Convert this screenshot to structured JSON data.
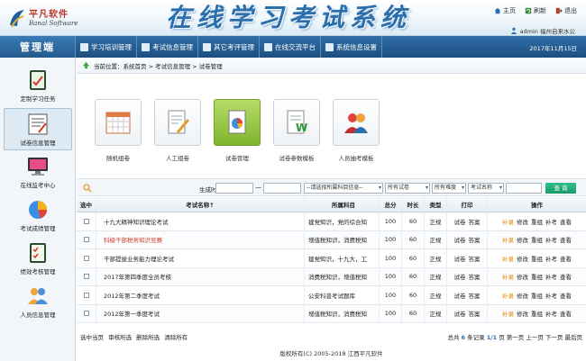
{
  "brand": {
    "name_cn": "平凡软件",
    "name_en": "Banal Software"
  },
  "app_title": "在线学习考试系统",
  "top_links": [
    {
      "label": "主页",
      "icon": "home-icon"
    },
    {
      "label": "刷新",
      "icon": "refresh-icon"
    },
    {
      "label": "退出",
      "icon": "exit-icon"
    }
  ],
  "user_line": "admin 福州自来水公",
  "sidebar_title": "管理端",
  "nav": [
    {
      "label": "学习培训管理"
    },
    {
      "label": "考试信息管理"
    },
    {
      "label": "其它考评管理"
    },
    {
      "label": "在线交流平台"
    },
    {
      "label": "系统信息设置"
    }
  ],
  "date": "2017年11月15日",
  "sidebar": [
    {
      "label": "定制学习任务",
      "icon": "task-icon"
    },
    {
      "label": "试卷信息管理",
      "icon": "exam-paper-icon",
      "active": true
    },
    {
      "label": "在线监考中心",
      "icon": "monitor-icon"
    },
    {
      "label": "考试成绩管理",
      "icon": "pie-chart-icon"
    },
    {
      "label": "绩效考核管理",
      "icon": "checklist-icon"
    },
    {
      "label": "人员信息管理",
      "icon": "users-icon"
    }
  ],
  "breadcrumb": "当前位置：系统首页 > 考试信息管理 > 试卷管理",
  "tiles": [
    {
      "label": "随机组卷",
      "icon": "calendar-grid-icon"
    },
    {
      "label": "人工组卷",
      "icon": "document-pen-icon"
    },
    {
      "label": "试卷管理",
      "icon": "paper-pie-icon",
      "active": true
    },
    {
      "label": "试卷参数模板",
      "icon": "word-doc-icon"
    },
    {
      "label": "人员抽考模板",
      "icon": "people-icon"
    }
  ],
  "filter": {
    "time_label": "生成时间",
    "date_from": "",
    "dash": "—",
    "date_to": "",
    "subject_select": "--请选择所属科目信息--",
    "exam_select": "所有试卷",
    "difficulty_select": "所有难度",
    "sort_select": "考试名称",
    "keyword": "",
    "query_button": "查 询"
  },
  "table": {
    "headers": [
      "选中",
      "考试名称↑",
      "所属科目",
      "总分",
      "时长",
      "类型",
      "打印",
      "操作"
    ],
    "rows": [
      {
        "name": "十九大精神知识理论考试",
        "subject": "建党知识，党的综合知",
        "total": "100",
        "duration": "60",
        "type": "正规",
        "print": [
          "试卷",
          "答案"
        ],
        "red": false
      },
      {
        "name": "科级干部税务知识竞赛",
        "subject": "增值税知识，消费税知",
        "total": "100",
        "duration": "60",
        "type": "正规",
        "print": [
          "试卷",
          "答案"
        ],
        "red": true
      },
      {
        "name": "干部提拔业务能力理论考试",
        "subject": "建党知识，十九大，工",
        "total": "100",
        "duration": "60",
        "type": "正规",
        "print": [
          "试卷",
          "答案"
        ],
        "red": false
      },
      {
        "name": "2017年第四季度全员考核",
        "subject": "消费税知识，增值税知",
        "total": "100",
        "duration": "60",
        "type": "正规",
        "print": [
          "试卷",
          "答案"
        ],
        "red": false
      },
      {
        "name": "2012年第二季度考试",
        "subject": "公安科普考试题库",
        "total": "100",
        "duration": "60",
        "type": "正规",
        "print": [
          "试卷",
          "答案"
        ],
        "red": false
      },
      {
        "name": "2012年第一季度考试",
        "subject": "增值税知识，消费税知",
        "total": "100",
        "duration": "60",
        "type": "正规",
        "print": [
          "试卷",
          "答案"
        ],
        "red": false
      }
    ],
    "actions": [
      "补录",
      "修改",
      "重组",
      "补考",
      "查看"
    ]
  },
  "footer_left": [
    "选中当页",
    "审核所选",
    "删除所选",
    "清除所有"
  ],
  "pagination": {
    "prefix": "总共",
    "total": "6",
    "mid": "条记录",
    "page": "1/1",
    "suffix": "页 第一页 上一页 下一页 最后页"
  },
  "copyright": "版权所有(C) 2005-2018 江西平凡软件"
}
